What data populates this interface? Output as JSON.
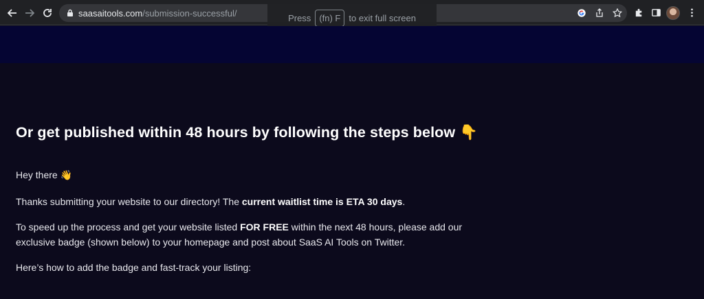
{
  "browser": {
    "url_domain": "saasaitools.com",
    "url_path": "/submission-successful/",
    "fullscreen_toast": {
      "before": "Press",
      "key": "(fn) F",
      "after": "to exit full screen"
    }
  },
  "icons": {
    "back": "back-arrow-icon",
    "forward": "forward-arrow-icon",
    "reload": "reload-icon",
    "lock": "lock-icon",
    "google": "google-icon",
    "share": "share-icon",
    "bookmark": "star-icon",
    "extensions": "puzzle-icon",
    "sidepanel": "side-panel-icon",
    "menu": "kebab-menu-icon"
  },
  "main": {
    "heading": "Or get published within 48 hours by following the steps below 👇",
    "greeting": "Hey there 👋",
    "thanks_prefix": "Thanks submitting your website to our directory! The ",
    "thanks_bold": "current waitlist time is ETA 30 days",
    "thanks_suffix": ".",
    "speed_prefix": "To speed up the process and get your website listed ",
    "speed_bold": "FOR FREE",
    "speed_suffix_line1": " within the next 48 hours, please add our",
    "speed_line2": "exclusive badge (shown below) to your homepage and post about SaaS AI Tools on Twitter.",
    "howto": "Here’s how to add the badge and fast-track your listing:"
  },
  "colors": {
    "page_bg": "#0c0a1c",
    "header_band": "#050533",
    "chrome_bg": "#202124"
  }
}
